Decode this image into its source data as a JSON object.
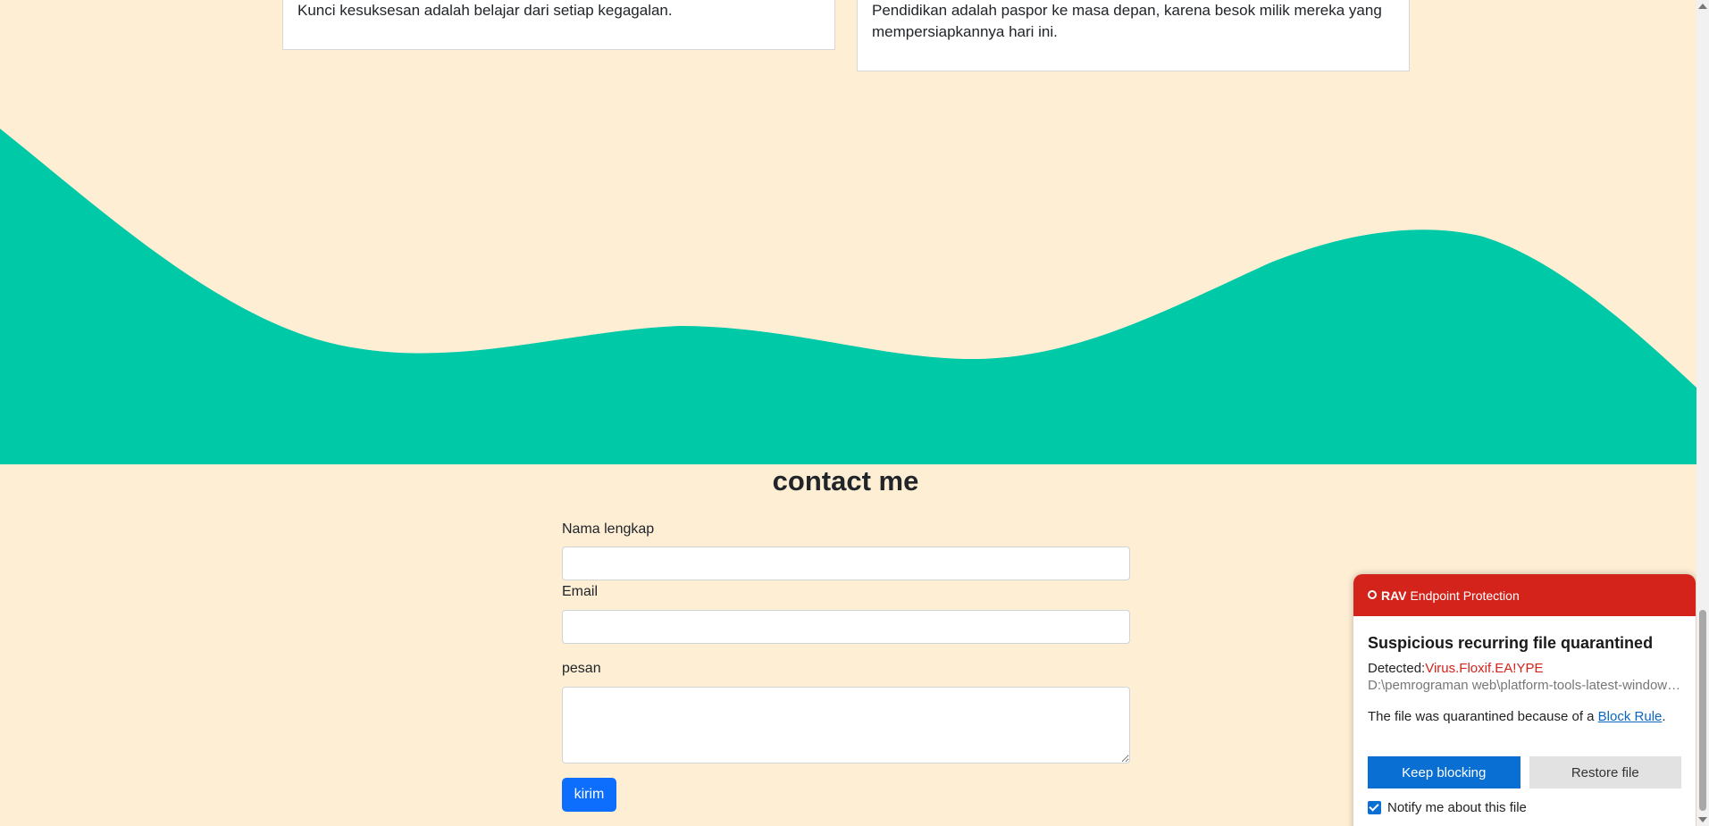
{
  "quotes": [
    {
      "text": "Kunci kesuksesan adalah belajar dari setiap kegagalan."
    },
    {
      "text": "Pendidikan adalah paspor ke masa depan, karena besok milik mereka yang mempersiapkannya hari ini."
    }
  ],
  "colors": {
    "background": "#feeed4",
    "wave": "#00c9a7",
    "primary_button": "#0d6efd",
    "popup_header": "#d3231b"
  },
  "contact": {
    "title": "contact me",
    "name_label": "Nama lengkap",
    "name_value": "",
    "email_label": "Email",
    "email_value": "",
    "message_label": "pesan",
    "message_value": "",
    "submit_label": "kirim"
  },
  "popup": {
    "brand": "RAV",
    "product": "Endpoint Protection",
    "title": "Suspicious recurring file quarantined",
    "detected_label": "Detected:",
    "virus_name": "Virus.Floxif.EA!YPE",
    "file_path": "D:\\pemrograman web\\platform-tools-latest-windows\\platform-tools",
    "reason_prefix": "The file was quarantined because of a ",
    "reason_link": "Block Rule",
    "reason_suffix": ".",
    "keep_label": "Keep blocking",
    "restore_label": "Restore file",
    "notify_label": "Notify me about this file",
    "notify_checked": true
  }
}
